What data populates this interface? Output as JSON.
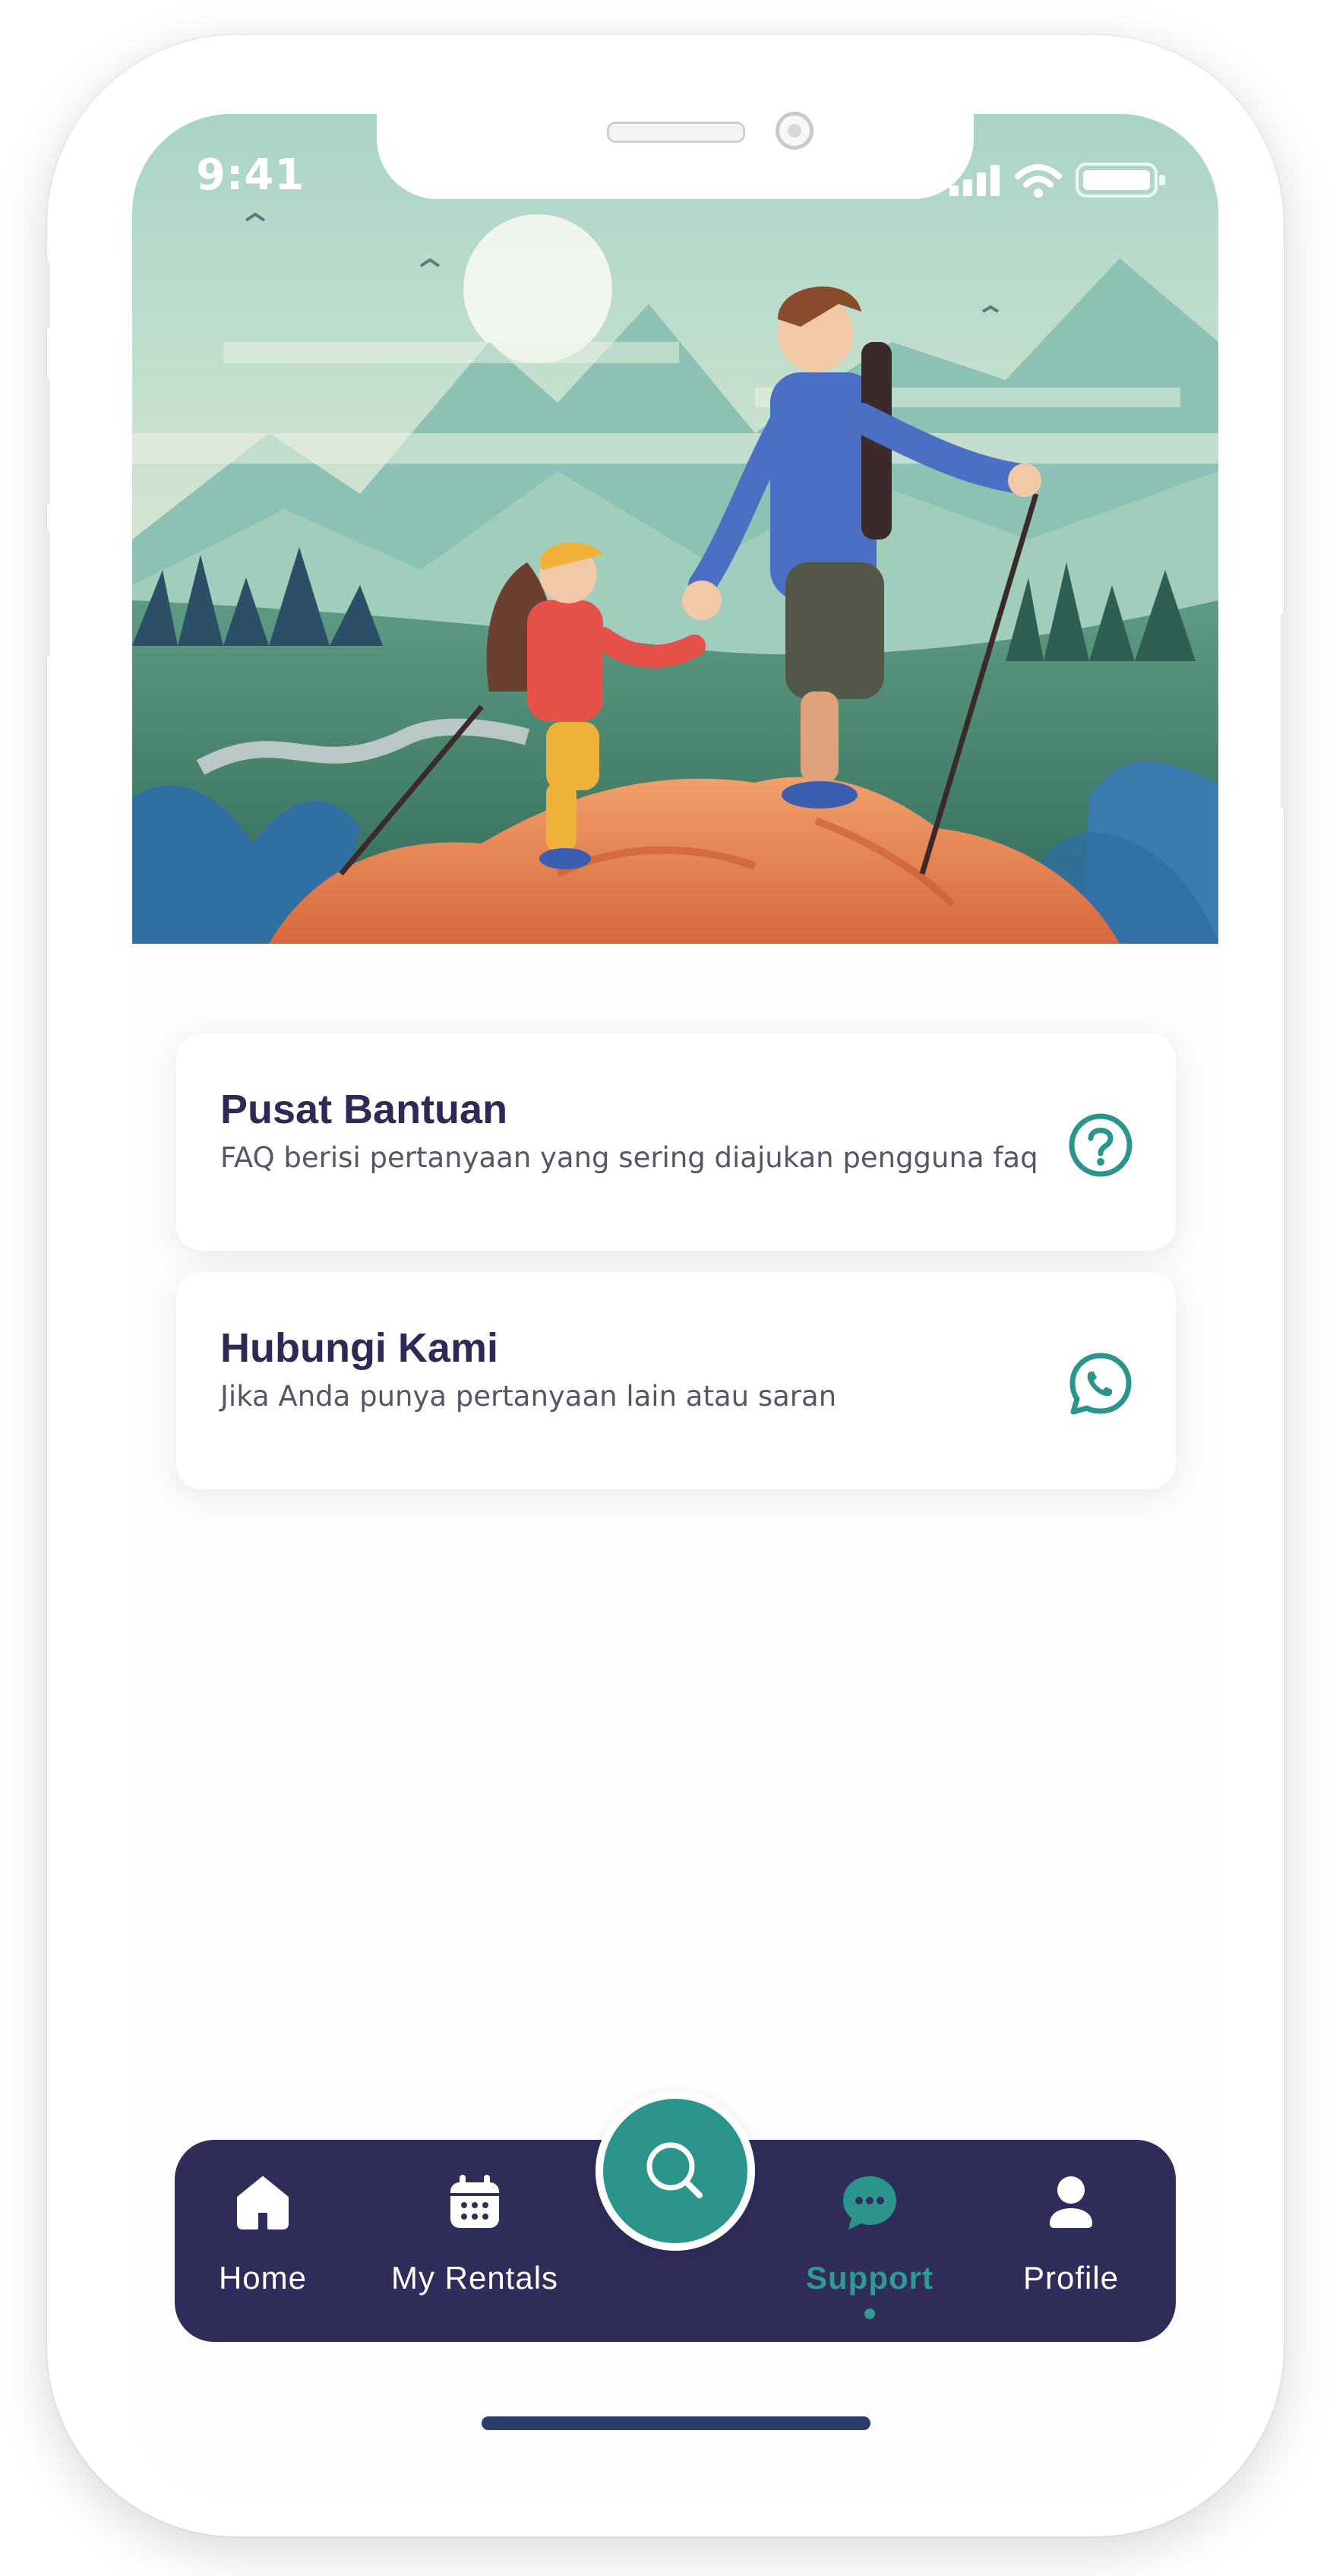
{
  "status_bar": {
    "time": "9:41"
  },
  "support_options": [
    {
      "title": "Pusat Bantuan",
      "description": "FAQ berisi pertanyaan yang sering diajukan pengguna faq",
      "icon": "help-circle-icon"
    },
    {
      "title": "Hubungi Kami",
      "description": "Jika Anda punya pertanyaan lain atau saran",
      "icon": "whatsapp-icon"
    }
  ],
  "bottom_nav": {
    "items": [
      {
        "label": "Home",
        "icon": "home-icon",
        "active": false
      },
      {
        "label": "My Rentals",
        "icon": "calendar-icon",
        "active": false
      },
      {
        "label": "Support",
        "icon": "chat-bubble-icon",
        "active": true
      },
      {
        "label": "Profile",
        "icon": "person-icon",
        "active": false
      }
    ],
    "center_button_icon": "search-icon"
  },
  "colors": {
    "accent": "#2b958c",
    "nav_background": "#312d5a",
    "title_text": "#2d2b55",
    "body_text": "#545766"
  }
}
